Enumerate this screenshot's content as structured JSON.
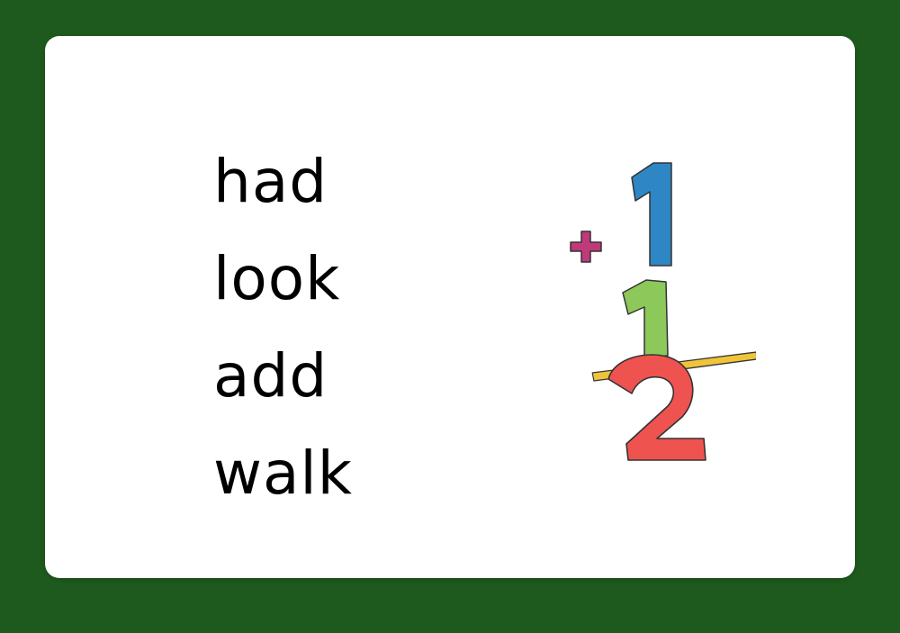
{
  "colors": {
    "background": "#1e5a1d",
    "card": "#ffffff",
    "text": "#000000",
    "plus": "#c03a7a",
    "one_top": "#2f86c4",
    "one_bottom": "#8cc85a",
    "bar": "#f0c43a",
    "two": "#ef5350"
  },
  "words": [
    "had",
    "look",
    "add",
    "walk"
  ],
  "illustration": {
    "icon": "addition-illustration-icon",
    "plus_sign": "+",
    "top_digit": "1",
    "bottom_digit": "1",
    "result_digit": "2"
  }
}
